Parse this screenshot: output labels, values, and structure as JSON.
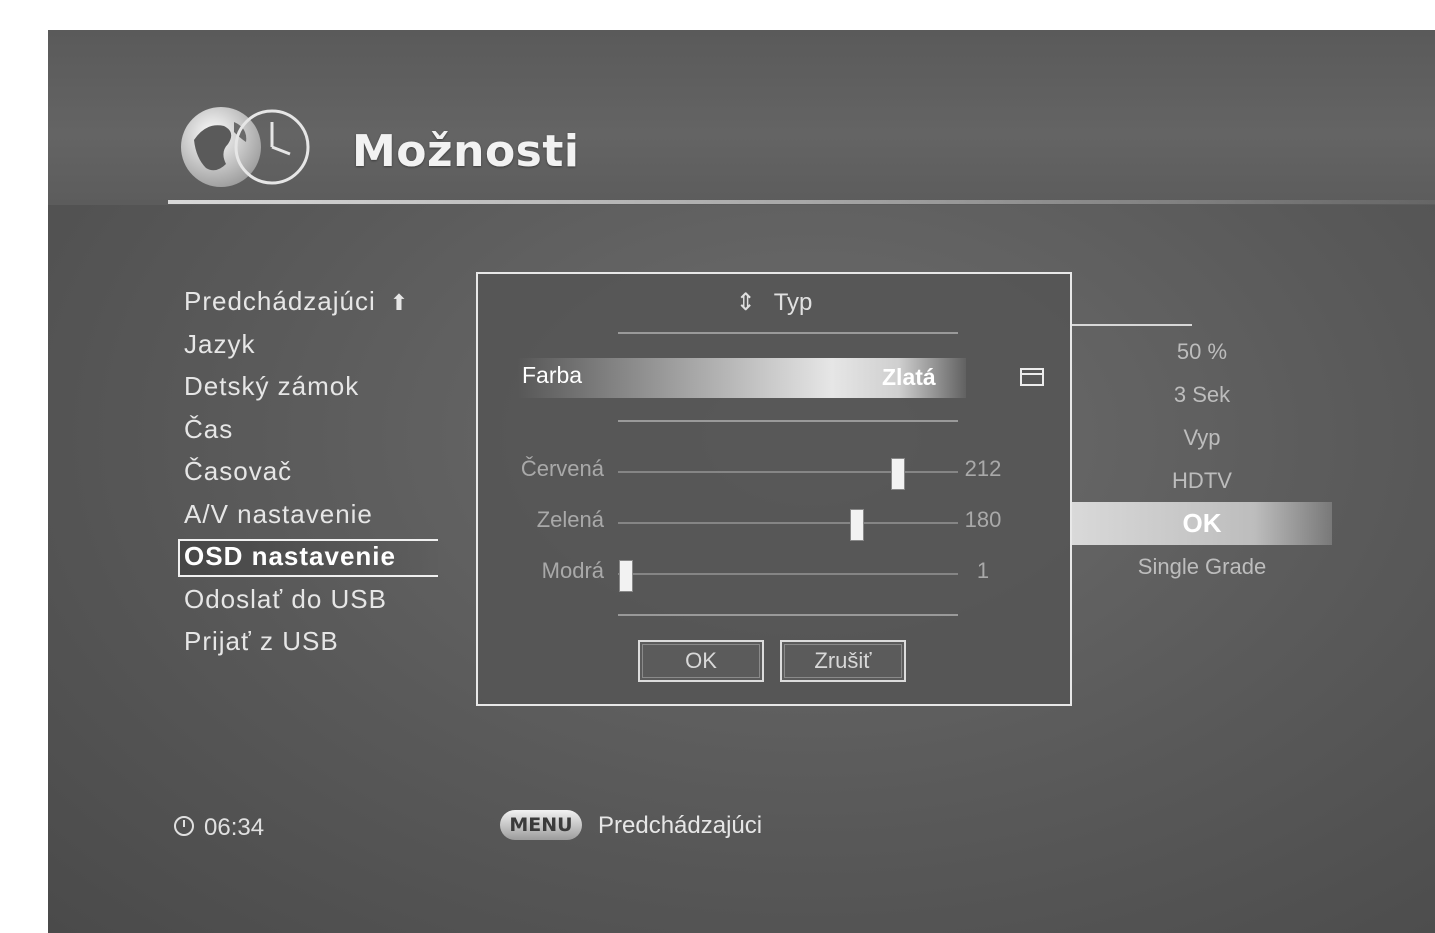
{
  "header": {
    "title": "Možnosti"
  },
  "menu": {
    "items": [
      {
        "label": "Predchádzajúci",
        "arrow": "⬆"
      },
      {
        "label": "Jazyk"
      },
      {
        "label": "Detský zámok"
      },
      {
        "label": "Čas"
      },
      {
        "label": "Časovač"
      },
      {
        "label": "A/V nastavenie"
      },
      {
        "label": "OSD nastavenie"
      },
      {
        "label": "Odoslať do USB"
      },
      {
        "label": "Prijať z USB"
      }
    ],
    "selected_index": 6
  },
  "values": {
    "items": [
      "50 %",
      "3 Sek",
      "Vyp",
      "HDTV",
      "OK",
      "Single Grade"
    ],
    "selected_index": 4
  },
  "dialog": {
    "header_arrows": "⇕",
    "header_label": "Typ",
    "color_label": "Farba",
    "color_value": "Zlatá",
    "sliders": [
      {
        "label": "Červená",
        "value": "212",
        "level": 212
      },
      {
        "label": "Zelená",
        "value": "180",
        "level": 180
      },
      {
        "label": "Modrá",
        "value": "1",
        "level": 1
      }
    ],
    "slider_max": 255,
    "ok_label": "OK",
    "cancel_label": "Zrušiť"
  },
  "footer": {
    "time": "06:34",
    "menu_key": "MENU",
    "hint": "Predchádzajúci"
  }
}
